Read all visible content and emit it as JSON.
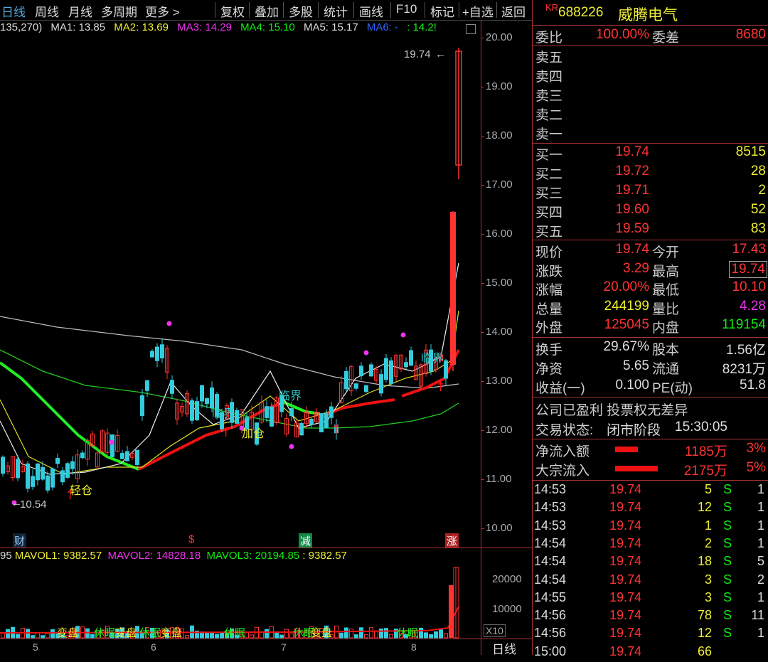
{
  "toolbar": {
    "items": [
      "日线",
      "周线",
      "月线",
      "多周期",
      "更多 >",
      "复权",
      "叠加",
      "多股",
      "统计",
      "画线",
      "F10",
      "标记",
      "+自选",
      "返回"
    ]
  },
  "ma": {
    "prefix": "135,270)",
    "ma1": "MA1: 13.85",
    "ma2": "MA2: 13.69",
    "ma3": "MA3: 14.29",
    "ma4": "MA4: 15.10",
    "ma5": "MA5: 15.17",
    "ma6": "MA6: -",
    "ma7": ": 14.2!"
  },
  "yaxis": [
    "20.00",
    "19.00",
    "18.00",
    "17.00",
    "16.00",
    "15.00",
    "14.00",
    "13.00",
    "12.00",
    "11.00",
    "10.00"
  ],
  "chart_annotations": {
    "high_label": "19.74",
    "low_label": "10.54",
    "labels": [
      "轻仓",
      "加仓",
      "临界",
      "临界",
      "临界"
    ],
    "events": [
      "财",
      "$",
      "减",
      "涨"
    ]
  },
  "volume": {
    "line": {
      "v0": "95",
      "mavol1": "MAVOL1: 9382.57",
      "mavol2": "MAVOL2: 14828.18",
      "mavol3": "MAVOL3: 20194.85",
      "mavol4": ": 9382.57"
    },
    "ticks": [
      "20000",
      "10000"
    ],
    "scale": "X10",
    "bottom_labels": [
      "变盘",
      "休眠",
      "变盘",
      "休眠",
      "变盘",
      "休眠",
      "休眠",
      "变盘",
      "休眠"
    ]
  },
  "xaxis": {
    "dates": [
      "5",
      "6",
      "7",
      "8"
    ],
    "period": "日线"
  },
  "stock": {
    "flag": "KR",
    "code": "688226",
    "name": "威腾电气"
  },
  "order_book": {
    "wb_label": "委比",
    "wb": "100.00%",
    "wc_label": "委差",
    "wc": "8680",
    "sells": [
      {
        "label": "卖五",
        "price": "",
        "vol": ""
      },
      {
        "label": "卖四",
        "price": "",
        "vol": ""
      },
      {
        "label": "卖三",
        "price": "",
        "vol": ""
      },
      {
        "label": "卖二",
        "price": "",
        "vol": ""
      },
      {
        "label": "卖一",
        "price": "",
        "vol": ""
      }
    ],
    "buys": [
      {
        "label": "买一",
        "price": "19.74",
        "vol": "8515"
      },
      {
        "label": "买二",
        "price": "19.72",
        "vol": "28"
      },
      {
        "label": "买三",
        "price": "19.71",
        "vol": "2"
      },
      {
        "label": "买四",
        "price": "19.60",
        "vol": "52"
      },
      {
        "label": "买五",
        "price": "19.59",
        "vol": "83"
      }
    ]
  },
  "quote": [
    {
      "l1": "现价",
      "v1": "19.74",
      "c1": "red",
      "l2": "今开",
      "v2": "17.43",
      "c2": "red"
    },
    {
      "l1": "涨跌",
      "v1": "3.29",
      "c1": "red",
      "l2": "最高",
      "v2": "19.74",
      "c2": "red"
    },
    {
      "l1": "涨幅",
      "v1": "20.00%",
      "c1": "red",
      "l2": "最低",
      "v2": "10.10",
      "c2": "red"
    },
    {
      "l1": "总量",
      "v1": "244199",
      "c1": "yel",
      "l2": "量比",
      "v2": "4.28",
      "c2": "mag"
    },
    {
      "l1": "外盘",
      "v1": "125045",
      "c1": "red",
      "l2": "内盘",
      "v2": "119154",
      "c2": "grn"
    }
  ],
  "fundamentals": [
    {
      "l1": "换手",
      "v1": "29.67%",
      "l2": "股本",
      "v2": "1.56亿"
    },
    {
      "l1": "净资",
      "v1": "5.65",
      "l2": "流通",
      "v2": "8231万"
    },
    {
      "l1": "收益(一)",
      "v1": "0.100",
      "l2": "PE(动)",
      "v2": "51.8"
    }
  ],
  "status": {
    "profit": "公司已盈利 投票权无差异",
    "trade_label": "交易状态:",
    "trade_state": "闭市阶段",
    "trade_time": "15:30:05"
  },
  "flows": [
    {
      "label": "净流入额",
      "amount": "1185万",
      "pct": "3%",
      "bar": 0.35
    },
    {
      "label": "大宗流入",
      "amount": "2175万",
      "pct": "5%",
      "bar": 0.65
    }
  ],
  "ticks": [
    {
      "time": "14:53",
      "price": "19.74",
      "vol": "5",
      "side": "S",
      "n": "1"
    },
    {
      "time": "14:53",
      "price": "19.74",
      "vol": "12",
      "side": "S",
      "n": "1"
    },
    {
      "time": "14:53",
      "price": "19.74",
      "vol": "1",
      "side": "S",
      "n": "1"
    },
    {
      "time": "14:54",
      "price": "19.74",
      "vol": "2",
      "side": "S",
      "n": "1"
    },
    {
      "time": "14:54",
      "price": "19.74",
      "vol": "18",
      "side": "S",
      "n": "5"
    },
    {
      "time": "14:54",
      "price": "19.74",
      "vol": "3",
      "side": "S",
      "n": "2"
    },
    {
      "time": "14:55",
      "price": "19.74",
      "vol": "3",
      "side": "S",
      "n": "1"
    },
    {
      "time": "14:56",
      "price": "19.74",
      "vol": "78",
      "side": "S",
      "n": "11"
    },
    {
      "time": "14:56",
      "price": "19.74",
      "vol": "12",
      "side": "S",
      "n": "1"
    },
    {
      "time": "15:00",
      "price": "19.74",
      "vol": "66",
      "side": "",
      "n": ""
    }
  ]
}
